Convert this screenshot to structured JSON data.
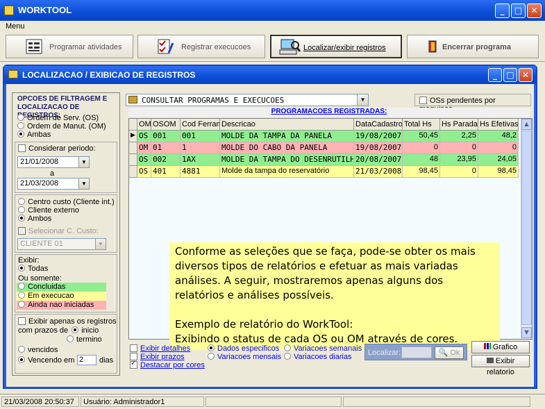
{
  "window": {
    "title": "WORKTOOL"
  },
  "menu": {
    "label": "Menu"
  },
  "toolbar": {
    "program": "Programar atividades",
    "register": "Registrar execucoes",
    "locate": "Localizar/exibir registros",
    "close": "Encerrar programa"
  },
  "inner": {
    "title": "LOCALIZACAO / EXIBICAO DE REGISTROS"
  },
  "filters": {
    "heading": "OPCOES DE FILTRAGEM E LOCALIZACAO DE REGISTROS:",
    "os": "Ordem de Serv. (OS)",
    "om": "Ordem de Manut. (OM)",
    "both": "Ambas",
    "period": "Considerar periodo:",
    "date_from": "21/01/2008",
    "to": "a",
    "date_to": "21/03/2008",
    "cost_center": "Centro custo (Cliente int.)",
    "ext_client": "Cliente externo",
    "both2": "Ambos",
    "select_cost": "Selecionar C. Custo:",
    "client": "CLIENTE 01",
    "show": "Exibir:",
    "all": "Todas",
    "or_only": "Ou somente:",
    "done": "Concluidas",
    "running": "Em execucao",
    "not_started": "Ainda nao iniciadas",
    "only_regs": "Exibir apenas os registros",
    "with_deadline": "com prazos de",
    "start": "inicio",
    "end": "termino",
    "expired": "vencidos",
    "expiring": "Vencendo em",
    "days_value": "2",
    "days": "dias"
  },
  "query": {
    "combo": "CONSULTAR PROGRAMAS E EXECUCOES",
    "pending": "OSs pendentes por maquinas",
    "grid_title": "PROGRAMACOES REGISTRADAS:"
  },
  "grid": {
    "headers": [
      "OM",
      "OSOM",
      "Cod Ferram",
      "Descricao",
      "DataCadastro",
      "Total Hs",
      "Hs Parada",
      "Hs Efetivas"
    ],
    "rows": [
      {
        "c": [
          "OS",
          "001",
          "001",
          "MOLDE DA TAMPA DA PANELA",
          "19/08/2007",
          "50,45",
          "2,25",
          "48,2"
        ],
        "color": "#90ee90"
      },
      {
        "c": [
          "OM",
          "01",
          "1",
          "MOLDE DO CABO DA PANELA",
          "19/08/2007",
          "0",
          "0",
          "0"
        ],
        "color": "#ffb3b3"
      },
      {
        "c": [
          "OS",
          "002",
          "1AX",
          "MOLDE DA TAMPA DO DESENRUTILH",
          "20/08/2007",
          "48",
          "23,95",
          "24,05"
        ],
        "color": "#90ee90"
      },
      {
        "c": [
          "OS",
          "401",
          "4881",
          "Molde da tampa do reservatório",
          "21/03/2008",
          "98,45",
          "0",
          "98,45"
        ],
        "color": "#ffff99"
      }
    ]
  },
  "note": {
    "p1": "Conforme as seleções que se faça, pode-se obter os mais diversos tipos de relatórios e efetuar as mais variadas análises. A seguir, mostraremos apenas alguns dos relatórios e análises possíveis.",
    "p2": "Exemplo de relatório do WorkTool:",
    "p3": "Exibindo o status de cada OS ou OM através de cores."
  },
  "bottom": {
    "details": "Exibir detalhes",
    "deadlines": "Exibir prazos",
    "colors": "Destacar por cores",
    "specific": "Dados especificos",
    "monthly": "Variacoes mensais",
    "weekly": "Variacoes semanais",
    "daily": "Variacoes diarias",
    "locate": "Localizar:",
    "ok": "Ok",
    "chart": "Grafico",
    "report": "Exibir relatorio"
  },
  "status": {
    "datetime": "21/03/2008 20:50:37",
    "user": "Usuário: Administrador1"
  },
  "colors": {
    "done": "#90ee90",
    "running": "#ffff99",
    "not_started": "#ffb3b3",
    "titlebar": "#0b4ed6"
  }
}
